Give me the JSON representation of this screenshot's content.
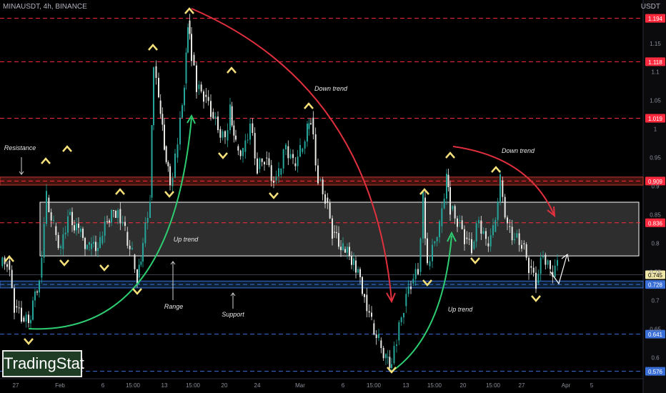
{
  "header": {
    "symbol": "MINAUSDT, 4h, BINANCE",
    "currency": "USDT"
  },
  "logo": {
    "text": "TradingStat"
  },
  "chart_data": {
    "type": "line",
    "title": "MINAUSDT, 4h, BINANCE",
    "ylim": [
      0.563,
      1.226
    ],
    "y_ticks": [
      1.15,
      1.1,
      1.05,
      1.0,
      0.95,
      0.9,
      0.85,
      0.8,
      0.75,
      0.7,
      0.65,
      0.6
    ],
    "x_ticks": [
      "27",
      "Feb",
      "6",
      "15:00",
      "13",
      "15:00",
      "20",
      "24",
      "Mar",
      "6",
      "15:00",
      "13",
      "15:00",
      "20",
      "15:00",
      "27",
      "Apr",
      "5"
    ],
    "key_levels": [
      {
        "label": "1.194",
        "value": 1.194,
        "style": "dashed",
        "color": "#ff2a3d",
        "tag_bg": "#ff2a3d"
      },
      {
        "label": "1.118",
        "value": 1.118,
        "style": "dashed",
        "color": "#ff2a3d",
        "tag_bg": "#ff2a3d"
      },
      {
        "label": "1.019",
        "value": 1.019,
        "style": "dashed",
        "color": "#ff2a3d",
        "tag_bg": "#ff2a3d"
      },
      {
        "label": "0.909",
        "value": 0.909,
        "style": "dashed",
        "color": "#ff2a3d",
        "tag_bg": "#ff2a3d"
      },
      {
        "label": "0.836",
        "value": 0.836,
        "style": "dashed",
        "color": "#ff2a3d",
        "tag_bg": "#ff2a3d"
      },
      {
        "label": "0.745",
        "value": 0.745,
        "style": "solid",
        "color": "#3a3d48",
        "tag_bg": "#f0e6a8"
      },
      {
        "label": "0.728",
        "value": 0.728,
        "style": "dashed",
        "color": "#3b6fd8",
        "tag_bg": "#3b6fd8"
      },
      {
        "label": "0.641",
        "value": 0.641,
        "style": "dashed",
        "color": "#3b6fd8",
        "tag_bg": "#3b6fd8"
      },
      {
        "label": "0.576",
        "value": 0.576,
        "style": "dashed",
        "color": "#3b6fd8",
        "tag_bg": "#3b6fd8"
      }
    ],
    "zones": [
      {
        "name": "resistance",
        "from": 0.902,
        "to": 0.916,
        "color": "#c0392b"
      },
      {
        "name": "range",
        "from": 0.778,
        "to": 0.872,
        "color": "#ffffff"
      },
      {
        "name": "support",
        "from": 0.722,
        "to": 0.734,
        "color": "#1e4f7a"
      }
    ],
    "series": [
      {
        "x": [
          0,
          10,
          20,
          30,
          40,
          55,
          65,
          75,
          85,
          95,
          110,
          125,
          140,
          150,
          165,
          175,
          185,
          192,
          200,
          210,
          215,
          222,
          230,
          238,
          245,
          252,
          258,
          263,
          268,
          275,
          285,
          295,
          305,
          315,
          322,
          330,
          340,
          350,
          360,
          370,
          383,
          390,
          400,
          410,
          420,
          430,
          435,
          445,
          455,
          465,
          480,
          495,
          510,
          520,
          530,
          540,
          548,
          555,
          565,
          575,
          585,
          592,
          598,
          605,
          615,
          625,
          630,
          640,
          650,
          660,
          670,
          680,
          690,
          700,
          710,
          720,
          730,
          740,
          750,
          760,
          770,
          780
        ],
        "values": [
          0.76,
          0.77,
          0.69,
          0.67,
          0.66,
          0.74,
          0.88,
          0.83,
          0.79,
          0.85,
          0.82,
          0.79,
          0.8,
          0.84,
          0.86,
          0.82,
          0.78,
          0.74,
          0.8,
          0.88,
          1.11,
          1.05,
          0.97,
          0.9,
          0.95,
          1.02,
          1.08,
          1.19,
          1.13,
          1.07,
          1.06,
          1.03,
          1.0,
          0.98,
          1.04,
          0.97,
          0.96,
          1.01,
          0.93,
          0.95,
          0.91,
          0.92,
          0.97,
          0.94,
          0.96,
          1.0,
          1.02,
          0.91,
          0.88,
          0.82,
          0.79,
          0.77,
          0.71,
          0.66,
          0.63,
          0.6,
          0.59,
          0.63,
          0.69,
          0.73,
          0.75,
          0.88,
          0.76,
          0.8,
          0.83,
          0.92,
          0.86,
          0.84,
          0.81,
          0.79,
          0.84,
          0.8,
          0.82,
          0.91,
          0.83,
          0.81,
          0.8,
          0.76,
          0.73,
          0.78,
          0.75,
          0.76
        ]
      }
    ],
    "annotations": [
      {
        "text": "Resistance"
      },
      {
        "text": "Up trend"
      },
      {
        "text": "Range"
      },
      {
        "text": "Support"
      },
      {
        "text": "Down trend"
      },
      {
        "text": "Up trend"
      },
      {
        "text": "Down trend"
      }
    ]
  }
}
